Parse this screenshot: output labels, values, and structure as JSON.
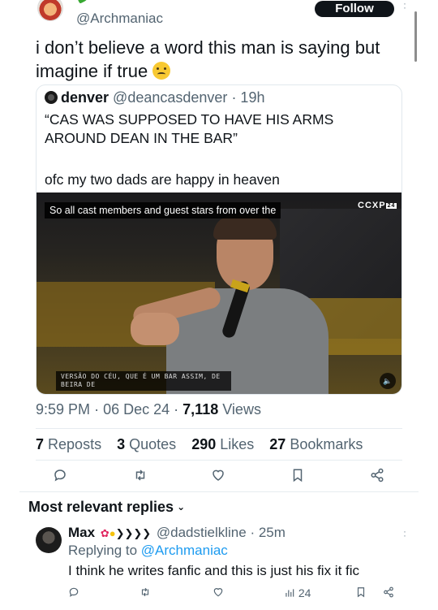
{
  "post": {
    "handle": "@Archmaniac",
    "follow_label": "Follow",
    "text": "i don’t believe a word this man is saying but imagine if true"
  },
  "quote": {
    "name": "denver",
    "handle": "@deancasdenver",
    "time": "· 19h",
    "text": "“CAS WAS SUPPOSED TO HAVE HIS ARMS AROUND DEAN IN THE BAR”",
    "text2": "ofc my two dads are happy in heaven",
    "video": {
      "caption": "So all cast members and guest stars from over the",
      "logo": "CCXP",
      "logo_badge": "24",
      "subtitle": "VERSÃO DO CÉU, QUE É UM BAR ASSIM, DE BEIRA DE"
    }
  },
  "meta": {
    "time": "9:59 PM",
    "date": "06 Dec 24",
    "views_count": "7,118",
    "views_label": "Views"
  },
  "stats": {
    "reposts_count": "7",
    "reposts_label": "Reposts",
    "quotes_count": "3",
    "quotes_label": "Quotes",
    "likes_count": "290",
    "likes_label": "Likes",
    "bookmarks_count": "27",
    "bookmarks_label": "Bookmarks"
  },
  "actions": [
    "reply-icon",
    "repost-icon",
    "like-icon",
    "bookmark-icon",
    "share-icon"
  ],
  "replies": {
    "sort_label": "Most relevant replies",
    "reply": {
      "name": "Max",
      "handle": "@dadstielkline",
      "time": "· 25m",
      "replying_prefix": "Replying to",
      "replying_to": "@Archmaniac",
      "text": "I think he writes fanfic and this is just his fix it fic",
      "views": "24"
    }
  },
  "colors": {
    "accent": "#1d9bf0",
    "text": "#0f1419",
    "muted": "#536471",
    "follow_bg": "#0f1419"
  }
}
